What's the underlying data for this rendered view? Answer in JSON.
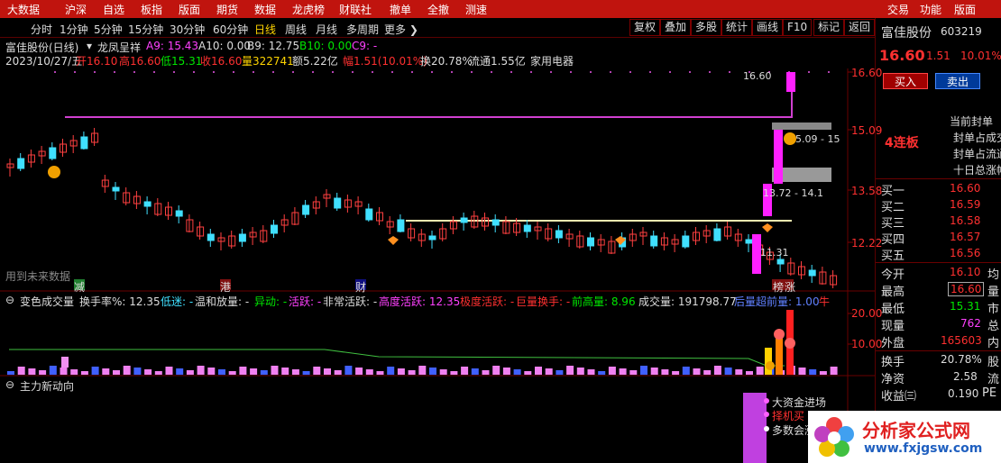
{
  "topbar": {
    "left_menu": [
      "大数据",
      "沪深",
      "自选",
      "板指",
      "版面",
      "期货",
      "数据",
      "龙虎榜",
      "财联社",
      "撤单",
      "全撤",
      "测速"
    ],
    "right_menu": [
      "交易",
      "功能",
      "版面"
    ],
    "window_controls": [
      "–",
      "▢",
      "✕"
    ]
  },
  "periods": [
    "分时",
    "1分钟",
    "5分钟",
    "15分钟",
    "30分钟",
    "60分钟",
    "日线",
    "周线",
    "月线",
    "多周期",
    "更多"
  ],
  "active_period": "日线",
  "more_label": "更多",
  "toolbar_buttons": [
    "复权",
    "叠加",
    "多股",
    "统计",
    "画线",
    "F10",
    "标记",
    "返回"
  ],
  "chart_header": {
    "stock": "富佳股份(日线)",
    "indicator": "龙凤呈祥",
    "a9": "A9: 15.43",
    "a10": "A10: 0.00",
    "b9": "B9: 12.75",
    "b10": "B10: 0.00",
    "c9": "C9: -",
    "date": "2023/10/27/五",
    "open": "开16.10",
    "high": "高16.60",
    "low": "低15.31",
    "close": "收16.60",
    "volume": "量322741",
    "amount": "额5.22亿",
    "change": "幅1.51(10.01%)",
    "turnover": "换20.78%",
    "float_cap": "流通1.55亿",
    "sector": "家用电器"
  },
  "price_axis": [
    "16.60",
    "15.09",
    "13.58",
    "12.22"
  ],
  "chart_labels": {
    "high_marker": "16.60",
    "low_marker": "11.31",
    "range1": "13.72 - 14.1",
    "range2": "5.09 - 15",
    "future": "用到未来数据",
    "tag_jian": "减",
    "tag_gang": "港",
    "tag_cai": "财",
    "tag_bang": "榜",
    "tag_zhang": "涨"
  },
  "volume_panel": {
    "name": "变色成交量",
    "turnover": "换手率%: 12.35",
    "low": "低迷: -",
    "mild": "温和放量: -",
    "abnormal": "异动: -",
    "active": "活跃: -",
    "very_active": "非常活跃: -",
    "high_active": "高度活跃: 12.35",
    "extreme": "极度活跃: -",
    "huge_turnover": "巨量换手: -",
    "prev_high": "前高量: 8.96",
    "volume": "成交量: 191798.77",
    "after_big": "后量超前量: 1.00",
    "bull": "牛",
    "axis": [
      "20.00",
      "10.00"
    ]
  },
  "main_force": {
    "name": "主力新动向",
    "msg1": "大资金进场",
    "msg2": "择机买",
    "msg3": "多数会涨"
  },
  "right_panel": {
    "name": "富佳股份",
    "code": "603219",
    "price": "16.60",
    "change": "1.51",
    "pct": "10.01%",
    "buy_btn": "买入",
    "sell_btn": "卖出",
    "streak": "4连板",
    "seal_lines": [
      "当前封单",
      "封单占成交",
      "封单占流通",
      "十日总涨幅"
    ],
    "bids": [
      {
        "label": "买一",
        "price": "16.60"
      },
      {
        "label": "买二",
        "price": "16.59"
      },
      {
        "label": "买三",
        "price": "16.58"
      },
      {
        "label": "买四",
        "price": "16.57"
      },
      {
        "label": "买五",
        "price": "16.56"
      }
    ],
    "stats": [
      {
        "label": "今开",
        "value": "16.10",
        "suffix": "均"
      },
      {
        "label": "最高",
        "value": "16.60",
        "suffix": "量"
      },
      {
        "label": "最低",
        "value": "15.31",
        "suffix": "市"
      },
      {
        "label": "现量",
        "value": "762",
        "suffix": "总"
      },
      {
        "label": "外盘",
        "value": "165603",
        "suffix": "内"
      },
      {
        "label": "换手",
        "value": "20.78%",
        "suffix": "股"
      },
      {
        "label": "净资",
        "value": "2.58",
        "suffix": "流"
      },
      {
        "label": "收益㈢",
        "value": "0.190",
        "suffix": "PE"
      }
    ]
  },
  "watermark": {
    "title": "分析家公式网",
    "url": "www.fxjgsw.com"
  }
}
